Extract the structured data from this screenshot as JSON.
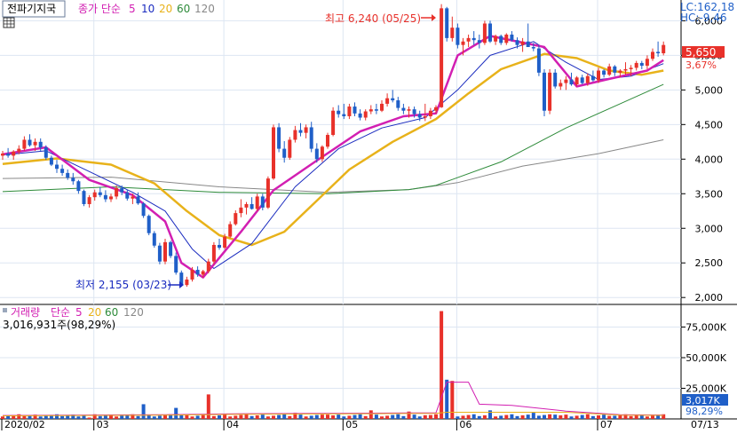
{
  "toolbar": {
    "tab_label": "전파기지국",
    "price_ma_title": "종가 단순",
    "ma_periods": [
      "5",
      "10",
      "20",
      "60",
      "120"
    ],
    "volume_label": "거래량",
    "volume_ma_title": "단순",
    "volume_ma_periods": [
      "5",
      "20",
      "60",
      "120"
    ],
    "volume_info": "3,016,931주(98,29%)"
  },
  "info": {
    "lc": "LC:162,18",
    "hc": "HC:-9,46",
    "current_price": "5,650",
    "current_change": "3,67%",
    "current_volume": "3,017K",
    "current_volume_pct": "98,29%"
  },
  "annotations": {
    "high": "최고 6,240 (05/25)",
    "low": "최저 2,155 (03/23)"
  },
  "colors": {
    "up": "#e8312a",
    "down": "#1f5fc8",
    "ma5": "#d21fb2",
    "ma10": "#1a2bbf",
    "ma20": "#e8b21a",
    "ma60": "#2e8b3a",
    "ma120": "#888888",
    "grid": "#dde6f2",
    "axis": "#000000",
    "price_label_bg": "#e8312a",
    "volume_label_bg": "#1f5fc8"
  },
  "icons": {
    "menu": "grid-icon"
  },
  "chart_data": [
    {
      "type": "candlestick",
      "y_ticks": [
        "2,000",
        "2,500",
        "3,000",
        "3,500",
        "4,000",
        "4,500",
        "5,000",
        "5,500",
        "6,000"
      ],
      "ylim": [
        1900,
        6300
      ],
      "x_labels": [
        "2020/02",
        "03",
        "04",
        "05",
        "06",
        "07",
        "07/13"
      ],
      "grid": true,
      "candles": [
        [
          4050,
          4120,
          3990,
          4080
        ],
        [
          4080,
          4160,
          4020,
          4050
        ],
        [
          4050,
          4130,
          3990,
          4110
        ],
        [
          4110,
          4200,
          4070,
          4150
        ],
        [
          4150,
          4330,
          4120,
          4280
        ],
        [
          4280,
          4360,
          4180,
          4200
        ],
        [
          4200,
          4300,
          4120,
          4250
        ],
        [
          4250,
          4300,
          4120,
          4170
        ],
        [
          4170,
          4200,
          3990,
          4020
        ],
        [
          4020,
          4050,
          3900,
          3920
        ],
        [
          3920,
          3990,
          3800,
          3860
        ],
        [
          3860,
          3920,
          3760,
          3800
        ],
        [
          3800,
          3850,
          3700,
          3730
        ],
        [
          3730,
          3800,
          3630,
          3680
        ],
        [
          3680,
          3700,
          3500,
          3540
        ],
        [
          3540,
          3560,
          3320,
          3350
        ],
        [
          3350,
          3480,
          3300,
          3450
        ],
        [
          3450,
          3560,
          3400,
          3520
        ],
        [
          3520,
          3600,
          3450,
          3480
        ],
        [
          3480,
          3550,
          3380,
          3420
        ],
        [
          3420,
          3500,
          3380,
          3460
        ],
        [
          3460,
          3620,
          3420,
          3580
        ],
        [
          3580,
          3620,
          3480,
          3520
        ],
        [
          3520,
          3560,
          3400,
          3430
        ],
        [
          3430,
          3500,
          3350,
          3460
        ],
        [
          3460,
          3520,
          3340,
          3360
        ],
        [
          3360,
          3380,
          3150,
          3180
        ],
        [
          3180,
          3200,
          2900,
          2930
        ],
        [
          2930,
          2960,
          2720,
          2750
        ],
        [
          2750,
          2790,
          2480,
          2520
        ],
        [
          2520,
          2850,
          2480,
          2800
        ],
        [
          2800,
          2820,
          2570,
          2600
        ],
        [
          2600,
          2650,
          2330,
          2360
        ],
        [
          2360,
          2390,
          2155,
          2180
        ],
        [
          2180,
          2300,
          2155,
          2260
        ],
        [
          2260,
          2440,
          2230,
          2400
        ],
        [
          2400,
          2450,
          2300,
          2330
        ],
        [
          2330,
          2400,
          2290,
          2380
        ],
        [
          2380,
          2560,
          2350,
          2520
        ],
        [
          2520,
          2800,
          2480,
          2760
        ],
        [
          2760,
          2850,
          2690,
          2720
        ],
        [
          2720,
          2920,
          2700,
          2880
        ],
        [
          2880,
          3100,
          2860,
          3060
        ],
        [
          3060,
          3260,
          3040,
          3220
        ],
        [
          3220,
          3420,
          3160,
          3300
        ],
        [
          3300,
          3380,
          3200,
          3350
        ],
        [
          3350,
          3450,
          3270,
          3280
        ],
        [
          3280,
          3500,
          3250,
          3460
        ],
        [
          3460,
          3500,
          3260,
          3300
        ],
        [
          3300,
          3750,
          3280,
          3720
        ],
        [
          3720,
          4500,
          3700,
          4460
        ],
        [
          4460,
          4520,
          4100,
          4150
        ],
        [
          4150,
          4260,
          3950,
          4020
        ],
        [
          4020,
          4320,
          3990,
          4280
        ],
        [
          4280,
          4480,
          4240,
          4420
        ],
        [
          4420,
          4520,
          4330,
          4380
        ],
        [
          4380,
          4500,
          4300,
          4460
        ],
        [
          4460,
          4540,
          4100,
          4150
        ],
        [
          4150,
          4230,
          3950,
          4000
        ],
        [
          4000,
          4200,
          3960,
          4180
        ],
        [
          4180,
          4380,
          4150,
          4350
        ],
        [
          4350,
          4750,
          4330,
          4700
        ],
        [
          4700,
          4780,
          4600,
          4650
        ],
        [
          4650,
          4800,
          4580,
          4620
        ],
        [
          4620,
          4800,
          4580,
          4760
        ],
        [
          4760,
          4820,
          4620,
          4660
        ],
        [
          4660,
          4720,
          4560,
          4600
        ],
        [
          4600,
          4720,
          4560,
          4690
        ],
        [
          4690,
          4780,
          4650,
          4720
        ],
        [
          4720,
          4800,
          4650,
          4700
        ],
        [
          4700,
          4850,
          4680,
          4800
        ],
        [
          4800,
          4950,
          4760,
          4880
        ],
        [
          4880,
          5000,
          4820,
          4850
        ],
        [
          4850,
          4900,
          4700,
          4740
        ],
        [
          4740,
          4800,
          4650,
          4700
        ],
        [
          4700,
          4760,
          4600,
          4720
        ],
        [
          4720,
          4760,
          4600,
          4650
        ],
        [
          4650,
          4700,
          4550,
          4600
        ],
        [
          4600,
          4800,
          4550,
          4620
        ],
        [
          4620,
          4740,
          4580,
          4700
        ],
        [
          4700,
          4780,
          4660,
          4750
        ],
        [
          4750,
          6240,
          4740,
          6180
        ],
        [
          6180,
          6200,
          5700,
          5750
        ],
        [
          5750,
          6060,
          5700,
          5900
        ],
        [
          5900,
          5960,
          5600,
          5650
        ],
        [
          5650,
          5750,
          5500,
          5700
        ],
        [
          5700,
          5800,
          5620,
          5750
        ],
        [
          5750,
          5850,
          5650,
          5720
        ],
        [
          5720,
          5800,
          5600,
          5680
        ],
        [
          5680,
          6000,
          5650,
          5960
        ],
        [
          5960,
          6000,
          5680,
          5700
        ],
        [
          5700,
          5800,
          5650,
          5780
        ],
        [
          5780,
          5800,
          5650,
          5680
        ],
        [
          5680,
          5820,
          5650,
          5800
        ],
        [
          5800,
          5850,
          5700,
          5720
        ],
        [
          5720,
          5760,
          5600,
          5650
        ],
        [
          5650,
          5750,
          5550,
          5700
        ],
        [
          5700,
          5960,
          5650,
          5620
        ],
        [
          5620,
          5680,
          5560,
          5600
        ],
        [
          5600,
          5650,
          5200,
          5250
        ],
        [
          5250,
          5300,
          4620,
          4700
        ],
        [
          4700,
          5300,
          4650,
          5250
        ],
        [
          5250,
          5300,
          5020,
          5050
        ],
        [
          5050,
          5150,
          5000,
          5100
        ],
        [
          5100,
          5200,
          5000,
          5150
        ],
        [
          5150,
          5250,
          5060,
          5080
        ],
        [
          5080,
          5200,
          5050,
          5180
        ],
        [
          5180,
          5220,
          5080,
          5100
        ],
        [
          5100,
          5240,
          5060,
          5200
        ],
        [
          5200,
          5280,
          5120,
          5140
        ],
        [
          5140,
          5320,
          5100,
          5280
        ],
        [
          5280,
          5300,
          5180,
          5220
        ],
        [
          5220,
          5380,
          5200,
          5340
        ],
        [
          5340,
          5360,
          5200,
          5250
        ],
        [
          5250,
          5300,
          5180,
          5280
        ],
        [
          5280,
          5400,
          5220,
          5300
        ],
        [
          5300,
          5360,
          5200,
          5320
        ],
        [
          5320,
          5420,
          5280,
          5390
        ],
        [
          5390,
          5420,
          5300,
          5350
        ],
        [
          5350,
          5500,
          5300,
          5450
        ],
        [
          5450,
          5600,
          5420,
          5550
        ],
        [
          5550,
          5700,
          5480,
          5530
        ],
        [
          5530,
          5700,
          5500,
          5650
        ]
      ],
      "ma5": [
        [
          0,
          4070
        ],
        [
          8,
          4170
        ],
        [
          16,
          3700
        ],
        [
          24,
          3480
        ],
        [
          30,
          3100
        ],
        [
          33,
          2500
        ],
        [
          37,
          2290
        ],
        [
          44,
          2950
        ],
        [
          50,
          3550
        ],
        [
          58,
          3980
        ],
        [
          66,
          4400
        ],
        [
          74,
          4620
        ],
        [
          80,
          4660
        ],
        [
          84,
          5500
        ],
        [
          90,
          5780
        ],
        [
          100,
          5620
        ],
        [
          106,
          5050
        ],
        [
          112,
          5160
        ],
        [
          119,
          5280
        ],
        [
          122,
          5430
        ]
      ],
      "ma10": [
        [
          0,
          4060
        ],
        [
          8,
          4120
        ],
        [
          16,
          3820
        ],
        [
          24,
          3520
        ],
        [
          30,
          3250
        ],
        [
          35,
          2700
        ],
        [
          39,
          2420
        ],
        [
          46,
          2780
        ],
        [
          54,
          3600
        ],
        [
          62,
          4150
        ],
        [
          70,
          4450
        ],
        [
          78,
          4600
        ],
        [
          84,
          5000
        ],
        [
          90,
          5500
        ],
        [
          98,
          5700
        ],
        [
          104,
          5400
        ],
        [
          110,
          5150
        ],
        [
          116,
          5200
        ],
        [
          122,
          5380
        ]
      ],
      "ma20": [
        [
          0,
          3930
        ],
        [
          10,
          4010
        ],
        [
          20,
          3920
        ],
        [
          28,
          3650
        ],
        [
          34,
          3250
        ],
        [
          40,
          2900
        ],
        [
          46,
          2760
        ],
        [
          52,
          2950
        ],
        [
          58,
          3400
        ],
        [
          64,
          3850
        ],
        [
          72,
          4250
        ],
        [
          80,
          4580
        ],
        [
          86,
          4950
        ],
        [
          92,
          5300
        ],
        [
          100,
          5520
        ],
        [
          106,
          5460
        ],
        [
          112,
          5280
        ],
        [
          118,
          5220
        ],
        [
          122,
          5280
        ]
      ],
      "ma60": [
        [
          0,
          3530
        ],
        [
          20,
          3600
        ],
        [
          40,
          3520
        ],
        [
          60,
          3500
        ],
        [
          75,
          3560
        ],
        [
          80,
          3620
        ],
        [
          92,
          3960
        ],
        [
          104,
          4450
        ],
        [
          114,
          4800
        ],
        [
          122,
          5080
        ]
      ],
      "ma120": [
        [
          0,
          3720
        ],
        [
          20,
          3740
        ],
        [
          40,
          3600
        ],
        [
          60,
          3520
        ],
        [
          75,
          3560
        ],
        [
          84,
          3660
        ],
        [
          96,
          3900
        ],
        [
          110,
          4080
        ],
        [
          122,
          4280
        ]
      ]
    },
    {
      "type": "bar",
      "name": "volume",
      "y_ticks": [
        "25,000K",
        "50,000K",
        "75,000K"
      ],
      "ylim": [
        0,
        92000
      ],
      "spikes": [
        [
          16,
          1100
        ],
        [
          26,
          12000
        ],
        [
          32,
          9000
        ],
        [
          38,
          20000
        ],
        [
          54,
          5000
        ],
        [
          59,
          3500
        ],
        [
          60,
          3500
        ],
        [
          68,
          7000
        ],
        [
          75,
          6000
        ],
        [
          78,
          3000
        ],
        [
          81,
          88000
        ],
        [
          82,
          32000
        ],
        [
          83,
          31000
        ],
        [
          90,
          7000
        ],
        [
          98,
          5000
        ],
        [
          102,
          3500
        ],
        [
          112,
          2500
        ],
        [
          118,
          3000
        ]
      ],
      "vol_ma": [
        [
          0,
          2800
        ],
        [
          30,
          3500
        ],
        [
          45,
          4300
        ],
        [
          60,
          4500
        ],
        [
          75,
          4900
        ],
        [
          80,
          5000
        ],
        [
          82,
          30000
        ],
        [
          86,
          30000
        ],
        [
          88,
          12000
        ],
        [
          94,
          11000
        ],
        [
          104,
          6400
        ],
        [
          114,
          3500
        ],
        [
          122,
          3200
        ]
      ]
    }
  ]
}
